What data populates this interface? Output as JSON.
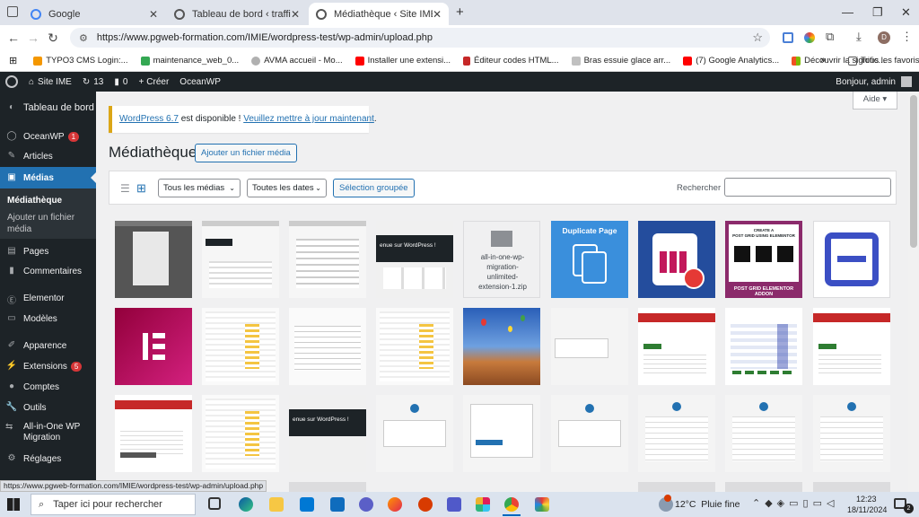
{
  "browser": {
    "tabs": [
      {
        "title": "Google",
        "active": false
      },
      {
        "title": "Tableau de bord ‹ traffic manag",
        "active": false
      },
      {
        "title": "Médiathèque ‹ Site IME — Wor",
        "active": true
      }
    ],
    "new_tab": "+",
    "url": "https://www.pgweb-formation.com/IMIE/wordpress-test/wp-admin/upload.php",
    "profile_letter": "D",
    "bookmarks": [
      "TYPO3 CMS Login:...",
      "maintenance_web_0...",
      "AVMA accueil - Mo...",
      "Installer une extensi...",
      "Éditeur codes HTML...",
      "Bras essuie glace arr...",
      "(7) Google Analytics...",
      "Découvrir la signific..."
    ],
    "bookmarks_more": "»",
    "all_bookmarks": "Tous les favoris"
  },
  "adminbar": {
    "site": "Site IME",
    "updates": "13",
    "comments": "0",
    "create": "Créer",
    "theme": "OceanWP",
    "greeting": "Bonjour, admin"
  },
  "sidebar": {
    "dashboard": "Tableau de bord",
    "oceanwp": "OceanWP",
    "oceanwp_badge": "1",
    "articles": "Articles",
    "medias": "Médias",
    "sub_library": "Médiathèque",
    "sub_add_line1": "Ajouter un fichier",
    "sub_add_line2": "média",
    "pages": "Pages",
    "comments": "Commentaires",
    "elementor": "Elementor",
    "models": "Modèles",
    "appearance": "Apparence",
    "extensions": "Extensions",
    "extensions_badge": "5",
    "accounts": "Comptes",
    "tools": "Outils",
    "aiowp_line1": "All-in-One WP",
    "aiowp_line2": "Migration",
    "settings": "Réglages"
  },
  "main": {
    "help": "Aide ▾",
    "notice_link1": "WordPress 6.7",
    "notice_text": " est disponible ! ",
    "notice_link2": "Veuillez mettre à jour maintenant",
    "notice_end": ".",
    "title": "Médiathèque",
    "add_button": "Ajouter un fichier média",
    "filter_media": "Tous les médias",
    "filter_dates": "Toutes les dates",
    "bulk_select": "Sélection groupée",
    "search_label": "Rechercher",
    "zip_label_1": "all-in-one-wp-",
    "zip_label_2": "migration-",
    "zip_label_3": "unlimited-",
    "zip_label_4": "extension-1.zip",
    "duplicate_title": "Duplicate Page",
    "postgrid_top_1": "CREATE A",
    "postgrid_top_2": "POST GRID USING ELEMENTOR",
    "postgrid_bottom": "POST GRID ELEMENTOR ADDON",
    "welcome_text": "enue sur WordPress !"
  },
  "status_url": "https://www.pgweb-formation.com/IMIE/wordpress-test/wp-admin/upload.php",
  "taskbar": {
    "search": "Taper ici pour rechercher",
    "weather": "12°C  Pluie fine",
    "time": "12:23",
    "date": "18/11/2024",
    "notif": "2"
  }
}
